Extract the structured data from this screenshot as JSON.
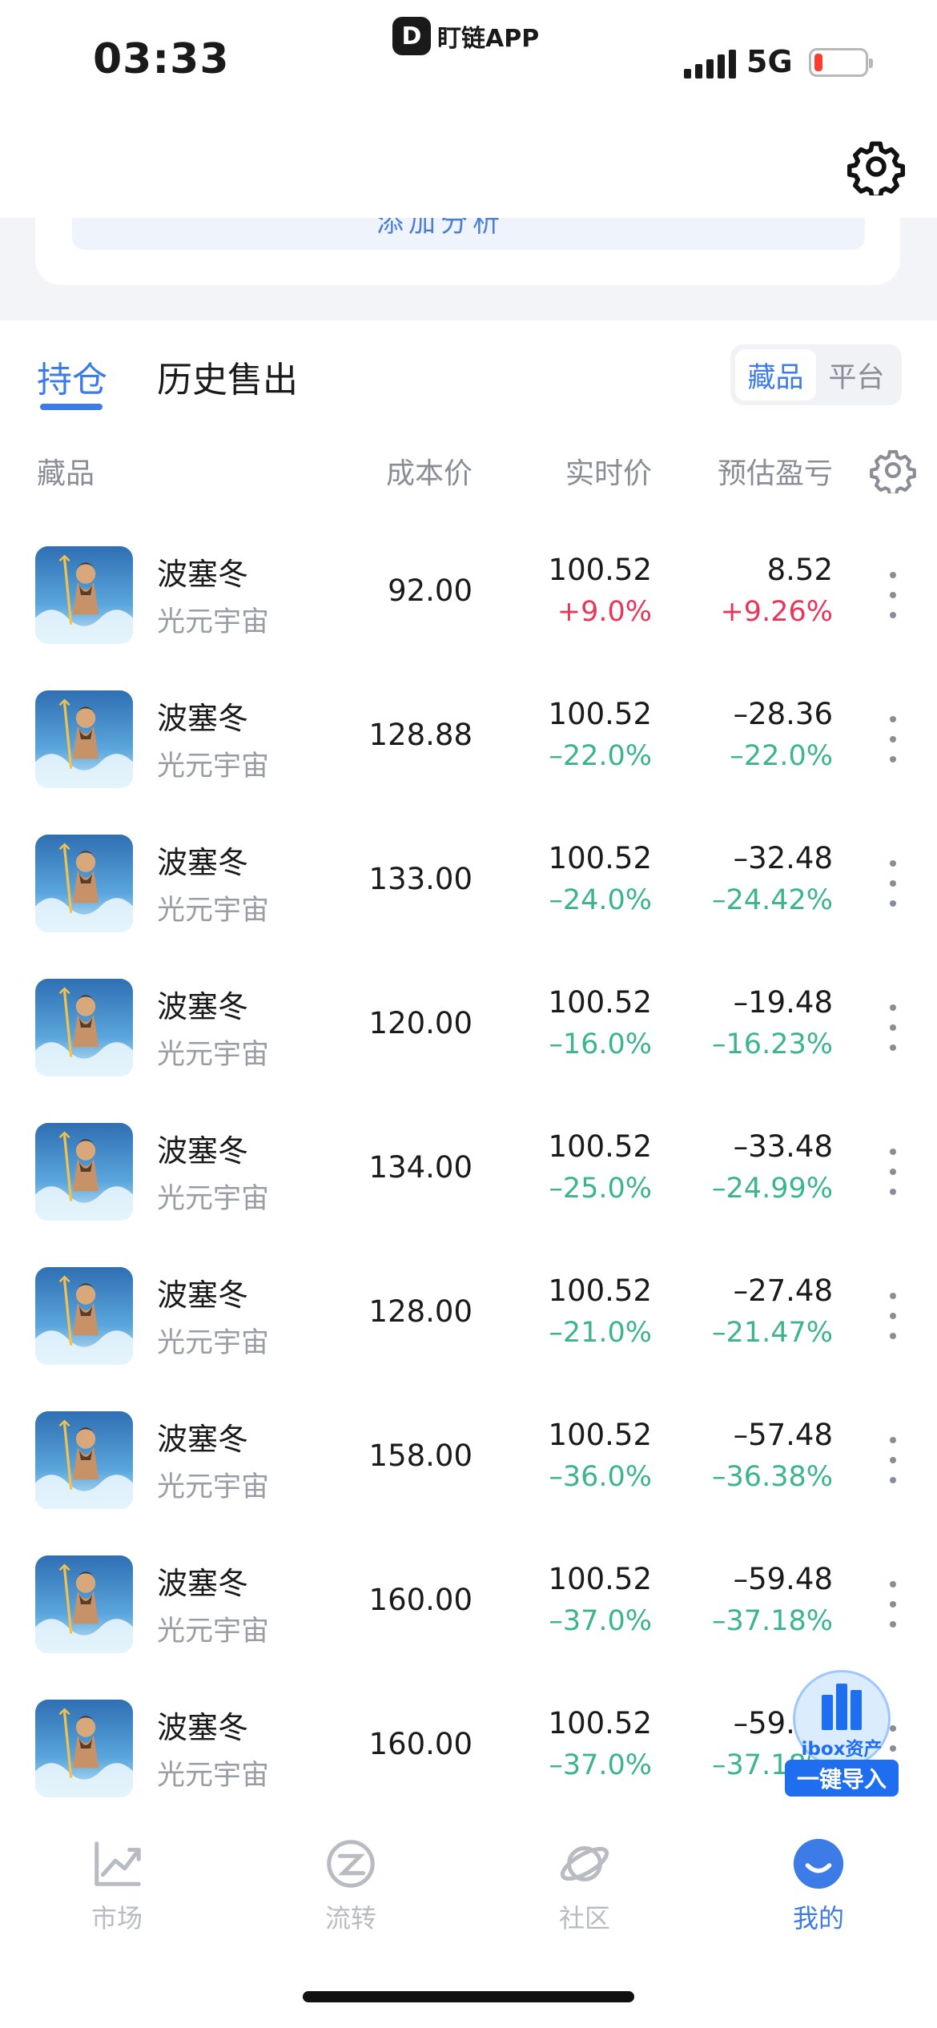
{
  "status_bar": {
    "time": "03:33",
    "network": "5G",
    "app_brand": "盯链APP",
    "app_logo_letter": "D",
    "battery_color": "#ff3b30"
  },
  "card_peek_text": "添加分析",
  "tabs": {
    "holdings": "持仓",
    "history": "历史售出"
  },
  "segment": {
    "options": [
      "藏品",
      "平台"
    ],
    "selected": "藏品"
  },
  "table_headers": {
    "name": "藏品",
    "cost": "成本价",
    "price": "实时价",
    "pnl": "预估盈亏"
  },
  "rows": [
    {
      "name": "波塞冬",
      "platform": "光元宇宙",
      "cost": "92.00",
      "price": "100.52",
      "price_change": "+9.0%",
      "pnl": "8.52",
      "pnl_pct": "+9.26%",
      "trend": "up"
    },
    {
      "name": "波塞冬",
      "platform": "光元宇宙",
      "cost": "128.88",
      "price": "100.52",
      "price_change": "–22.0%",
      "pnl": "–28.36",
      "pnl_pct": "–22.0%",
      "trend": "down"
    },
    {
      "name": "波塞冬",
      "platform": "光元宇宙",
      "cost": "133.00",
      "price": "100.52",
      "price_change": "–24.0%",
      "pnl": "–32.48",
      "pnl_pct": "–24.42%",
      "trend": "down"
    },
    {
      "name": "波塞冬",
      "platform": "光元宇宙",
      "cost": "120.00",
      "price": "100.52",
      "price_change": "–16.0%",
      "pnl": "–19.48",
      "pnl_pct": "–16.23%",
      "trend": "down"
    },
    {
      "name": "波塞冬",
      "platform": "光元宇宙",
      "cost": "134.00",
      "price": "100.52",
      "price_change": "–25.0%",
      "pnl": "–33.48",
      "pnl_pct": "–24.99%",
      "trend": "down"
    },
    {
      "name": "波塞冬",
      "platform": "光元宇宙",
      "cost": "128.00",
      "price": "100.52",
      "price_change": "–21.0%",
      "pnl": "–27.48",
      "pnl_pct": "–21.47%",
      "trend": "down"
    },
    {
      "name": "波塞冬",
      "platform": "光元宇宙",
      "cost": "158.00",
      "price": "100.52",
      "price_change": "–36.0%",
      "pnl": "–57.48",
      "pnl_pct": "–36.38%",
      "trend": "down"
    },
    {
      "name": "波塞冬",
      "platform": "光元宇宙",
      "cost": "160.00",
      "price": "100.52",
      "price_change": "–37.0%",
      "pnl": "–59.48",
      "pnl_pct": "–37.18%",
      "trend": "down"
    },
    {
      "name": "波塞冬",
      "platform": "光元宇宙",
      "cost": "160.00",
      "price": "100.52",
      "price_change": "–37.0%",
      "pnl": "–59.48",
      "pnl_pct": "–37.18%",
      "trend": "down"
    }
  ],
  "ibox_badge": {
    "text": "ibox资产",
    "button": "一键导入"
  },
  "bottom_nav": [
    {
      "label": "市场",
      "icon": "chart-icon"
    },
    {
      "label": "流转",
      "icon": "transfer-icon"
    },
    {
      "label": "社区",
      "icon": "planet-icon"
    },
    {
      "label": "我的",
      "icon": "profile-icon",
      "active": true
    }
  ],
  "colors": {
    "accent": "#3d7be6",
    "gain": "#e8365a",
    "loss": "#3cb48e",
    "muted": "#8a8d96"
  }
}
